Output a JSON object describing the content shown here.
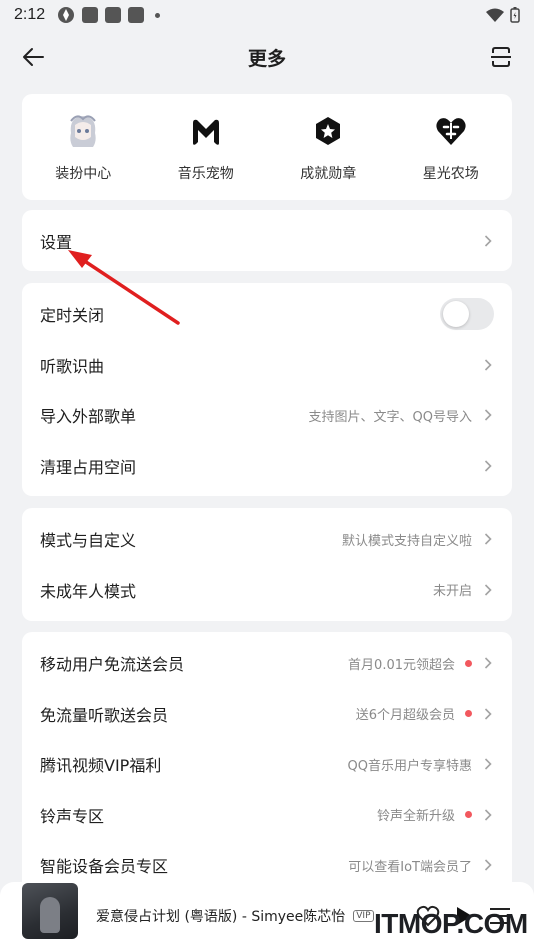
{
  "status_bar": {
    "time": "2:12"
  },
  "header": {
    "title": "更多"
  },
  "quick_actions": [
    {
      "label": "装扮中心",
      "icon": "anime-avatar-icon"
    },
    {
      "label": "音乐宠物",
      "icon": "m-logo-icon"
    },
    {
      "label": "成就勋章",
      "icon": "medal-star-icon"
    },
    {
      "label": "星光农场",
      "icon": "farm-heart-icon"
    }
  ],
  "settings": {
    "label": "设置"
  },
  "group1": [
    {
      "label": "定时关闭"
    },
    {
      "label": "听歌识曲"
    },
    {
      "label": "导入外部歌单",
      "hint": "支持图片、文字、QQ号导入"
    },
    {
      "label": "清理占用空间"
    }
  ],
  "group2": [
    {
      "label": "模式与自定义",
      "hint": "默认模式支持自定义啦"
    },
    {
      "label": "未成年人模式",
      "hint": "未开启"
    }
  ],
  "group3": [
    {
      "label": "移动用户免流送会员",
      "hint": "首月0.01元领超会"
    },
    {
      "label": "免流量听歌送会员",
      "hint": "送6个月超级会员"
    },
    {
      "label": "腾讯视频VIP福利",
      "hint": "QQ音乐用户专享特惠"
    },
    {
      "label": "铃声专区",
      "hint": "铃声全新升级"
    },
    {
      "label": "智能设备会员专区",
      "hint": "可以查看IoT端会员了"
    }
  ],
  "player": {
    "song": "爱意侵占计划 (粤语版) - Simyee陈芯怡",
    "vip": "VIP"
  },
  "watermark": "ITMOP.COM",
  "colors": {
    "red_dot": "#f2585e",
    "arrow": "#e01f1f",
    "background": "#f1f2f4"
  }
}
